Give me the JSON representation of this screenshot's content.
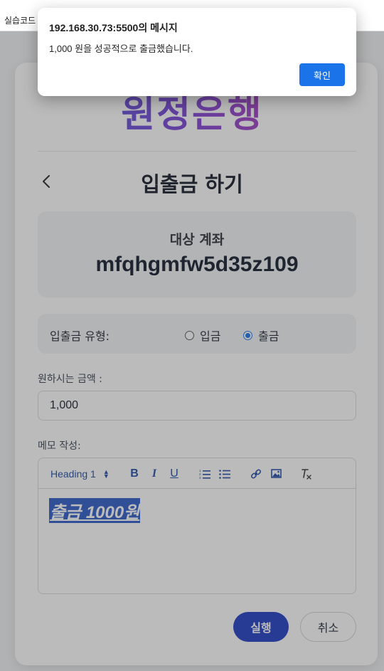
{
  "browser": {
    "bookmark_label": "실습코드"
  },
  "app": {
    "logo_text": "원정은행",
    "page_title": "입출금 하기"
  },
  "account": {
    "label": "대상 계좌",
    "number": "mfqhgmfw5d35z109"
  },
  "transaction_type": {
    "label": "입출금 유형:",
    "options": [
      {
        "label": "입금",
        "selected": false
      },
      {
        "label": "출금",
        "selected": true
      }
    ]
  },
  "amount": {
    "label": "원하시는 금액 :",
    "value": "1,000"
  },
  "memo": {
    "label": "메모 작성:",
    "toolbar": {
      "heading_select": "Heading 1",
      "bold": "B",
      "italic": "I",
      "underline": "U"
    },
    "content": "출금 1000원"
  },
  "actions": {
    "submit_label": "실행",
    "cancel_label": "취소"
  },
  "dialog": {
    "title": "192.168.30.73:5500의 메시지",
    "message": "1,000 원을 성공적으로 출금했습니다.",
    "ok_label": "확인"
  },
  "colors": {
    "primary_button": "#1d39c4",
    "dialog_ok": "#1a73e8",
    "toolbar_icon": "#1e4aa8",
    "selection_highlight": "#2c59c8"
  }
}
